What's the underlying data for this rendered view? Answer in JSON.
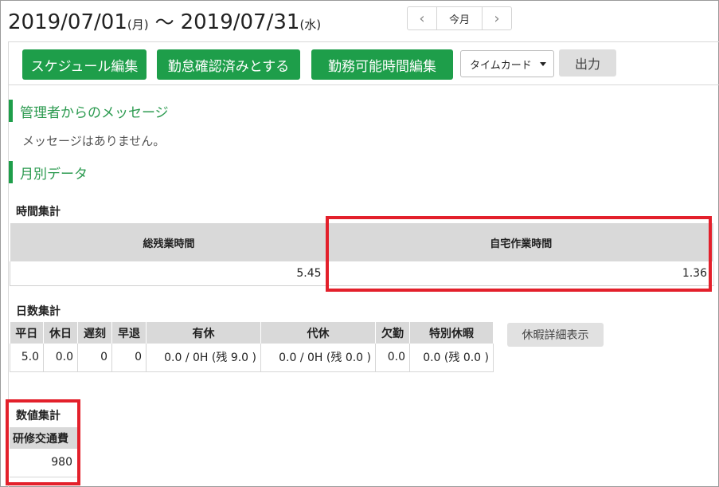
{
  "header": {
    "start_date": "2019/07/01",
    "start_day": "(月)",
    "separator": "〜",
    "end_date": "2019/07/31",
    "end_day": "(水)",
    "prev_icon": "‹",
    "today_label": "今月",
    "next_icon": "›"
  },
  "toolbar": {
    "schedule_edit": "スケジュール編集",
    "confirm_attendance": "勤怠確認済みとする",
    "available_hours_edit": "勤務可能時間編集",
    "output_type_selected": "タイムカード",
    "output_label": "出力"
  },
  "admin_message": {
    "title": "管理者からのメッセージ",
    "body": "メッセージはありません。"
  },
  "monthly": {
    "title": "月別データ"
  },
  "hours_summary": {
    "title": "時間集計",
    "headers": [
      "総残業時間",
      "自宅作業時間"
    ],
    "values": [
      "5.45",
      "1.36"
    ]
  },
  "days_summary": {
    "title": "日数集計",
    "headers": [
      "平日",
      "休日",
      "遅刻",
      "早退",
      "有休",
      "代休",
      "欠勤",
      "特別休暇"
    ],
    "values": [
      "5.0",
      "0.0",
      "0",
      "0",
      "0.0 / 0H (残 9.0 )",
      "0.0 / 0H (残 0.0 )",
      "0.0",
      "0.0 (残 0.0 )"
    ],
    "leave_detail_button": "休暇詳細表示"
  },
  "numeric_summary": {
    "title": "数値集計",
    "header": "研修交通費",
    "value": "980"
  },
  "colors": {
    "accent_green": "#1e9e4a",
    "highlight_red": "#e3202b",
    "header_gray": "#d9d9d9"
  }
}
